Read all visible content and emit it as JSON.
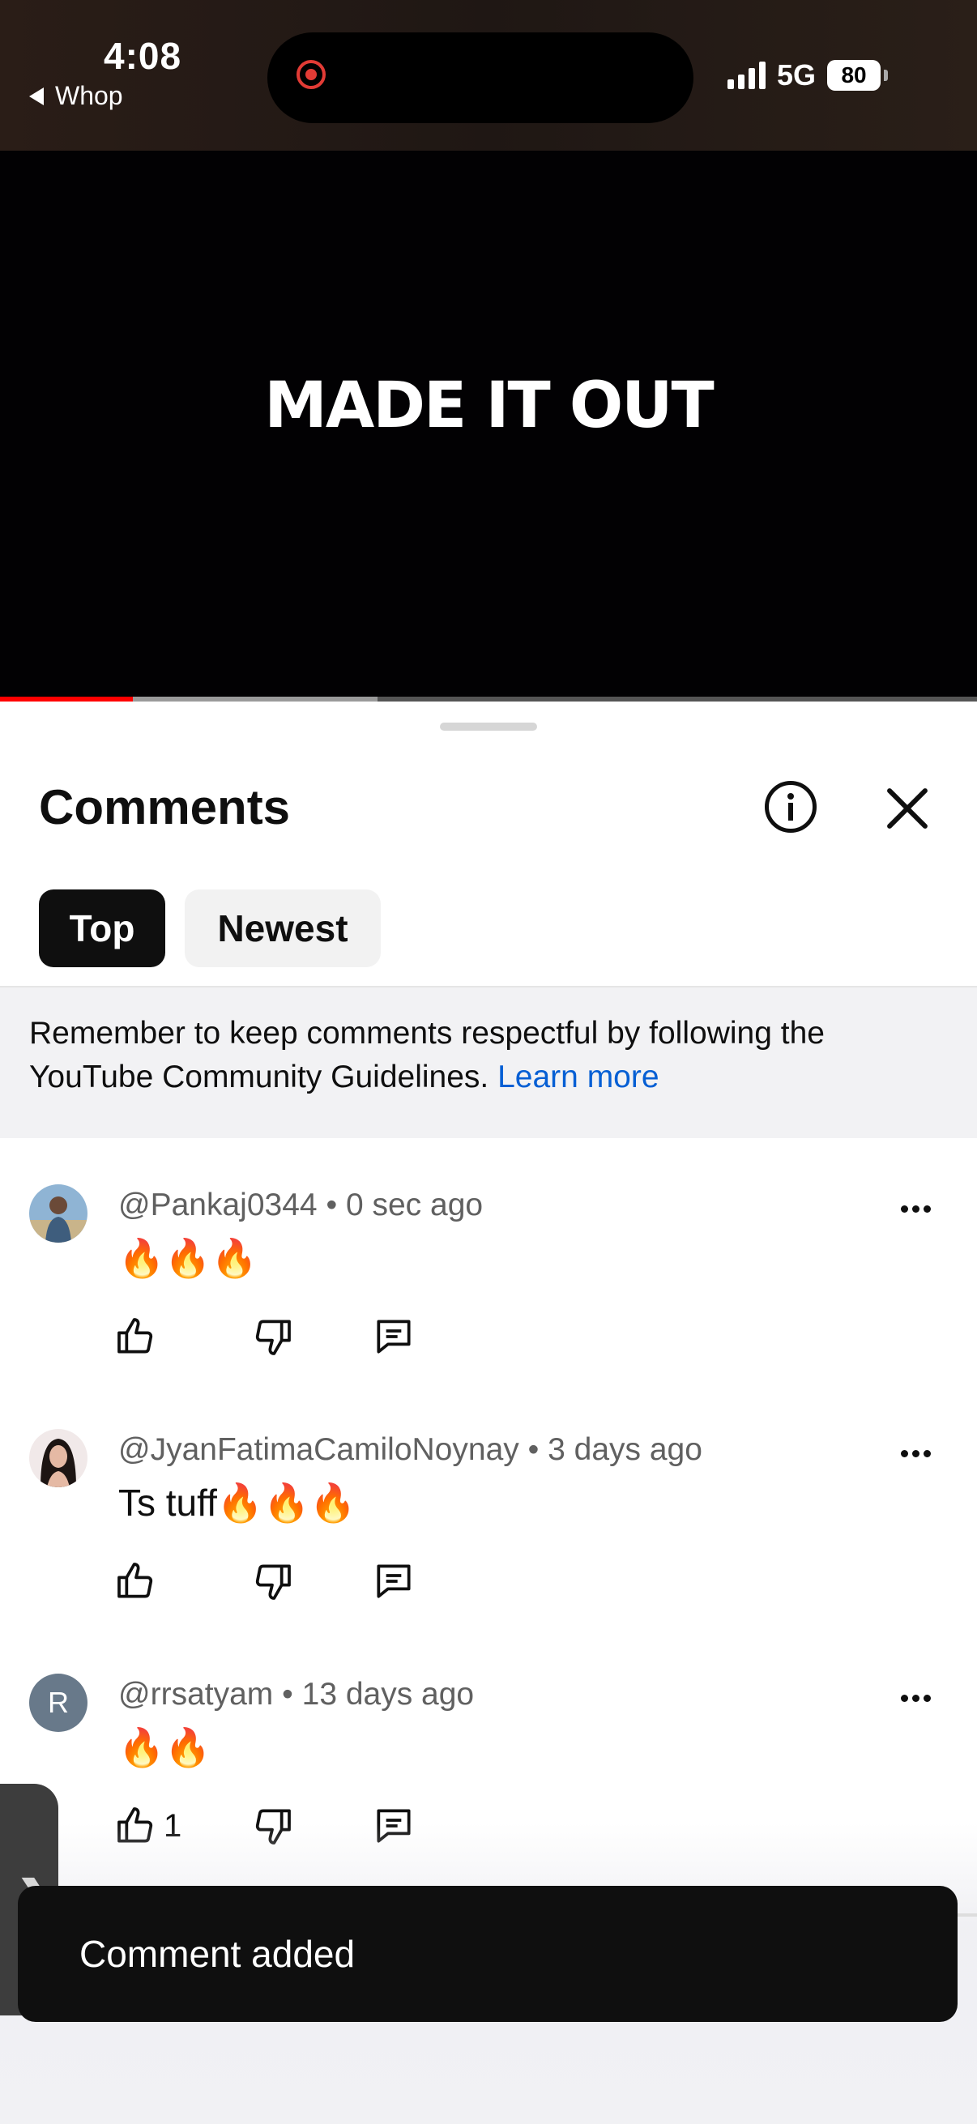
{
  "status_bar": {
    "time": "4:08",
    "back_app": "Whop",
    "network": "5G",
    "battery": "80"
  },
  "video": {
    "title_text": "MADE IT OUT",
    "progress_played_fraction": 0.136,
    "progress_buffered_fraction": 0.386
  },
  "comments_panel": {
    "title": "Comments",
    "info_icon": "info-circle-icon",
    "close_icon": "close-icon",
    "tabs": [
      {
        "label": "Top",
        "selected": true
      },
      {
        "label": "Newest",
        "selected": false
      }
    ],
    "notice": {
      "text": "Remember to keep comments respectful by following the YouTube Community Guidelines.",
      "link_label": "Learn more"
    },
    "comments": [
      {
        "handle": "@Pankaj0344",
        "time": "0 sec ago",
        "text": "🔥🔥🔥",
        "likes": ""
      },
      {
        "handle": "@JyanFatimaCamiloNoynay",
        "time": "3 days ago",
        "text": "Ts tuff🔥🔥🔥",
        "likes": ""
      },
      {
        "handle": "@rrsatyam",
        "time": "13 days ago",
        "text": "🔥🔥",
        "likes": "1",
        "avatar_letter": "R"
      }
    ]
  },
  "toast": {
    "message": "Comment added"
  },
  "colors": {
    "accent_link": "#065fd4",
    "progress_red": "#ff0000",
    "chip_selected_bg": "#0f0f0f"
  }
}
